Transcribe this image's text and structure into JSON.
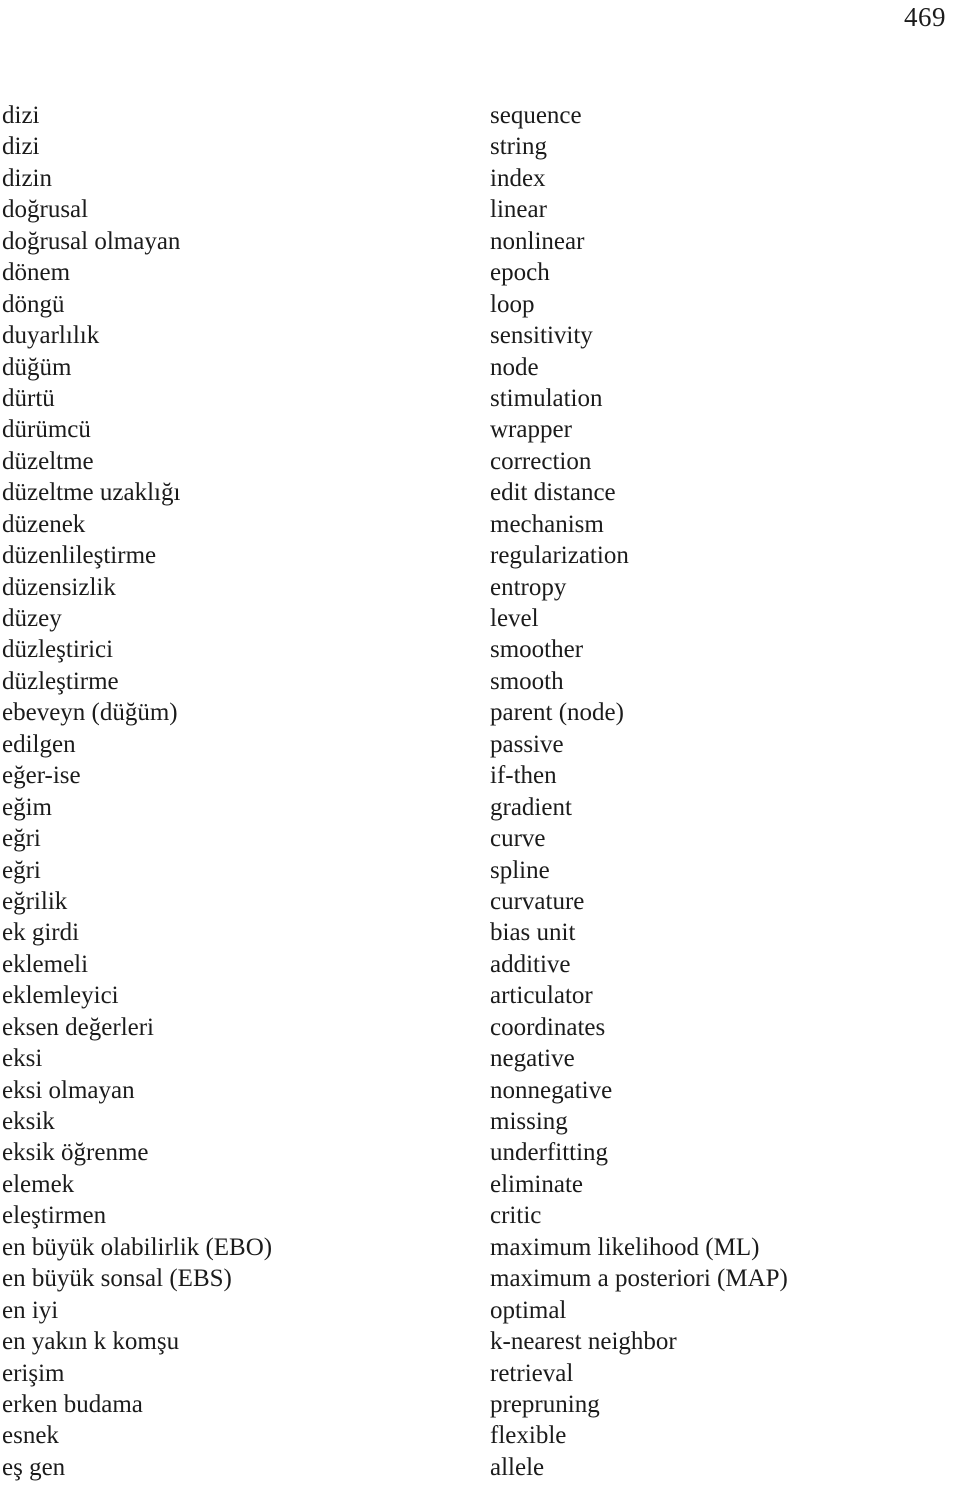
{
  "page": {
    "number": "469"
  },
  "glossary": {
    "entries": [
      {
        "term": "dizi",
        "gloss": "sequence"
      },
      {
        "term": "dizi",
        "gloss": "string"
      },
      {
        "term": "dizin",
        "gloss": "index"
      },
      {
        "term": "doğrusal",
        "gloss": "linear"
      },
      {
        "term": "doğrusal olmayan",
        "gloss": "nonlinear"
      },
      {
        "term": "dönem",
        "gloss": "epoch"
      },
      {
        "term": "döngü",
        "gloss": "loop"
      },
      {
        "term": "duyarlılık",
        "gloss": "sensitivity"
      },
      {
        "term": "düğüm",
        "gloss": "node"
      },
      {
        "term": "dürtü",
        "gloss": "stimulation"
      },
      {
        "term": "dürümcü",
        "gloss": "wrapper"
      },
      {
        "term": "düzeltme",
        "gloss": "correction"
      },
      {
        "term": "düzeltme uzaklığı",
        "gloss": "edit distance"
      },
      {
        "term": "düzenek",
        "gloss": "mechanism"
      },
      {
        "term": "düzenlileştirme",
        "gloss": "regularization"
      },
      {
        "term": "düzensizlik",
        "gloss": "entropy"
      },
      {
        "term": "düzey",
        "gloss": "level"
      },
      {
        "term": "düzleştirici",
        "gloss": "smoother"
      },
      {
        "term": "düzleştirme",
        "gloss": "smooth"
      },
      {
        "term": "ebeveyn (düğüm)",
        "gloss": "parent (node)"
      },
      {
        "term": "edilgen",
        "gloss": "passive"
      },
      {
        "term": "eğer-ise",
        "gloss": "if-then"
      },
      {
        "term": "eğim",
        "gloss": "gradient"
      },
      {
        "term": "eğri",
        "gloss": "curve"
      },
      {
        "term": "eğri",
        "gloss": "spline"
      },
      {
        "term": "eğrilik",
        "gloss": "curvature"
      },
      {
        "term": "ek girdi",
        "gloss": "bias unit"
      },
      {
        "term": "eklemeli",
        "gloss": "additive"
      },
      {
        "term": "eklemleyici",
        "gloss": "articulator"
      },
      {
        "term": "eksen değerleri",
        "gloss": "coordinates"
      },
      {
        "term": "eksi",
        "gloss": "negative"
      },
      {
        "term": "eksi olmayan",
        "gloss": "nonnegative"
      },
      {
        "term": "eksik",
        "gloss": "missing"
      },
      {
        "term": "eksik öğrenme",
        "gloss": "underfitting"
      },
      {
        "term": "elemek",
        "gloss": "eliminate"
      },
      {
        "term": "eleştirmen",
        "gloss": "critic"
      },
      {
        "term": "en büyük olabilirlik (EBO)",
        "gloss": "maximum likelihood (ML)"
      },
      {
        "term": "en büyük sonsal (EBS)",
        "gloss": "maximum a posteriori (MAP)"
      },
      {
        "term": "en iyi",
        "gloss": "optimal"
      },
      {
        "term": "en yakın k komşu",
        "gloss": "k-nearest neighbor"
      },
      {
        "term": "erişim",
        "gloss": "retrieval"
      },
      {
        "term": "erken budama",
        "gloss": "prepruning"
      },
      {
        "term": "esnek",
        "gloss": "flexible"
      },
      {
        "term": "eş gen",
        "gloss": "allele"
      }
    ]
  }
}
